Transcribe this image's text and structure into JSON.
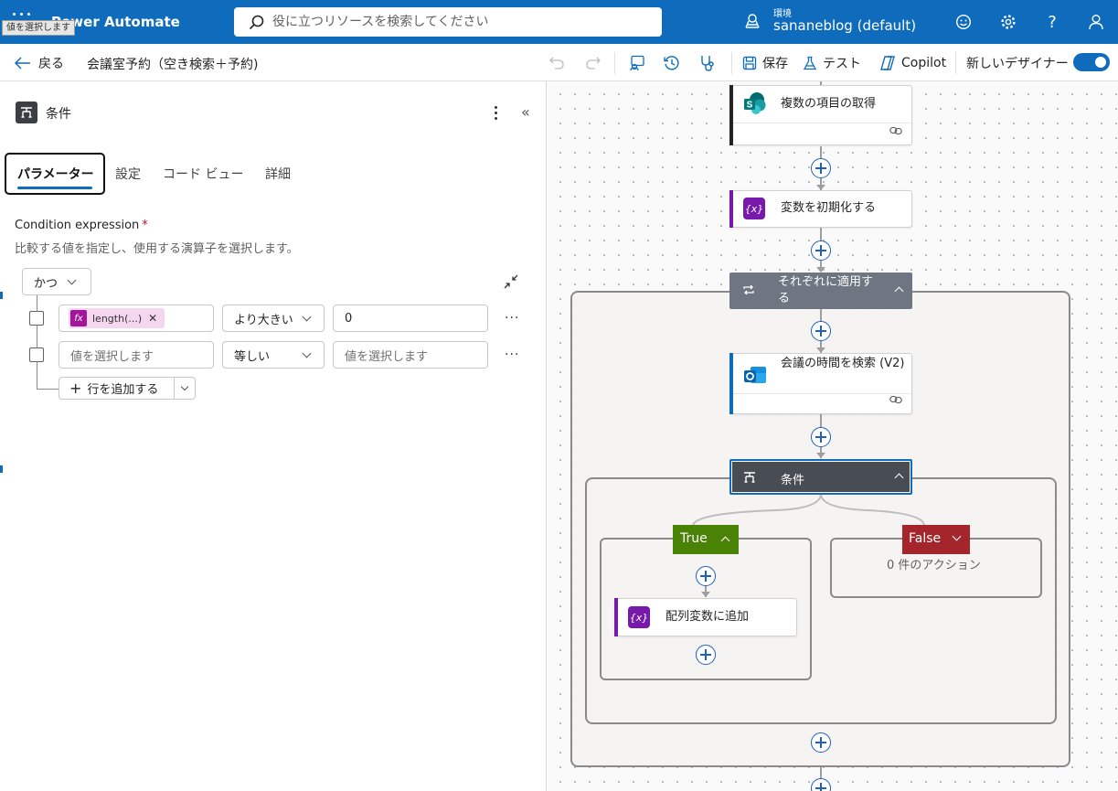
{
  "app": {
    "title": "Power Automate",
    "tooltip": "値を選択します",
    "search_placeholder": "役に立つリソースを検索してください",
    "env_label": "環境",
    "env_name": "sananeblog (default)"
  },
  "icons": {
    "top": [
      "environment-icon",
      "feedback-smiley-icon",
      "settings-gear-icon",
      "help-icon",
      "account-icon"
    ],
    "command": [
      "undo-icon",
      "redo-icon",
      "flow-checker-icon",
      "history-icon",
      "health-icon"
    ]
  },
  "commandbar": {
    "back": "戻る",
    "flow_name": "会議室予約（空き検索＋予約)",
    "save": "保存",
    "test": "テスト",
    "copilot": "Copilot",
    "new_designer": "新しいデザイナー",
    "new_designer_on": true
  },
  "panel": {
    "title": "条件",
    "tabs": [
      "パラメーター",
      "設定",
      "コード ビュー",
      "詳細"
    ],
    "active_tab": 0,
    "condition_label": "Condition expression",
    "required_mark": "*",
    "condition_desc": "比較する値を指定し、使用する演算子を選択します。",
    "group_operator": "かつ",
    "rows": [
      {
        "left_token": "length(...)",
        "left_placeholder": "",
        "operator": "より大きい",
        "right_value": "0",
        "right_placeholder": ""
      },
      {
        "left_token": "",
        "left_placeholder": "値を選択します",
        "operator": "等しい",
        "right_value": "",
        "right_placeholder": "値を選択します"
      }
    ],
    "add_row": "行を追加する",
    "more": "···"
  },
  "canvas": {
    "steps": {
      "get_items": "複数の項目の取得",
      "init_var": "変数を初期化する",
      "apply_each": "それぞれに適用する",
      "find_meeting_times": "会議の時間を検索 (V2)",
      "condition": "条件",
      "append_array": "配列変数に追加"
    },
    "branches": {
      "true_label": "True",
      "false_label": "False",
      "false_empty": "0 件のアクション"
    }
  },
  "colors": {
    "brand_blue": "#0f6cbd",
    "variable_purple": "#7719aa",
    "condition_dark": "#484c53",
    "true_green": "#498205",
    "false_red": "#a4262c",
    "apply_each_gray": "#6e7681"
  }
}
